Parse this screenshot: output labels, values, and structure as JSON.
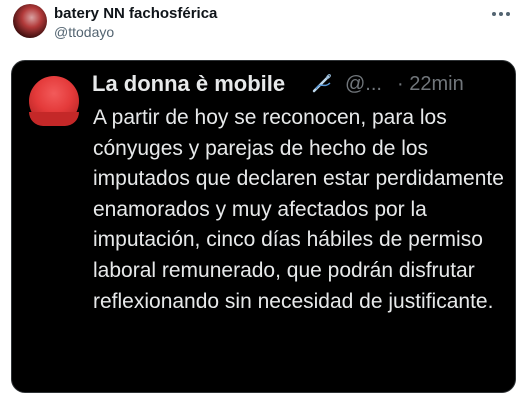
{
  "tweet": {
    "author_name": "batery NN fachosférica",
    "author_handle": "@ttodayo",
    "more_icon": "more-dots-icon"
  },
  "quoted": {
    "author_name": "La donna è mobile",
    "author_icon": "needle-thread-icon",
    "author_handle": "@...",
    "separator": "·",
    "time": "22min",
    "text": "A partir de hoy se reconocen, para los cónyuges y parejas de hecho de los imputados que declaren estar perdidamente enamorados y muy afectados por la imputación, cinco días hábiles de permiso laboral remunerado, que podrán disfrutar reflexionando sin necesidad de justificante."
  },
  "colors": {
    "card_bg": "#000000",
    "text_light": "#e7e9ea",
    "text_muted": "#71767b",
    "name_dark": "#0f1419"
  }
}
